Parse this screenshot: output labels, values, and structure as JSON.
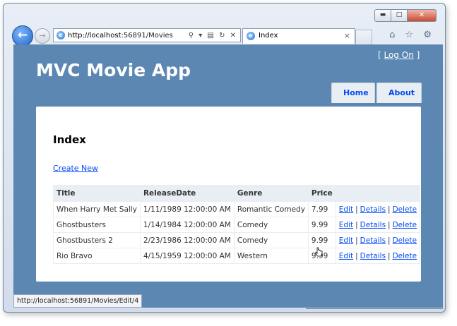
{
  "browser": {
    "address_host": "http://localhost",
    "address_path": ":56891/Movies",
    "tab_title": "Index",
    "tab_close": "×",
    "status_url": "http://localhost:56891/Movies/Edit/4",
    "back_glyph": "←",
    "forward_glyph": "→",
    "address_tools": "⚲ ▾ ▤ ↻ ✕",
    "window_controls": {
      "min": "▬",
      "max": "□",
      "close": "✕"
    },
    "command_icons": "⌂ ☆ ⚙"
  },
  "site": {
    "logon_prefix": "[ ",
    "logon_label": "Log On",
    "logon_suffix": " ]",
    "title": "MVC Movie App",
    "nav": [
      "Home",
      "About"
    ]
  },
  "content": {
    "heading": "Index",
    "create_link": "Create New",
    "columns": [
      "Title",
      "ReleaseDate",
      "Genre",
      "Price",
      ""
    ],
    "rows": [
      {
        "title": "When Harry Met Sally",
        "release": "1/11/1989 12:00:00 AM",
        "genre": "Romantic Comedy",
        "price": "7.99"
      },
      {
        "title": "Ghostbusters",
        "release": "1/14/1984 12:00:00 AM",
        "genre": "Comedy",
        "price": "9.99"
      },
      {
        "title": "Ghostbusters 2",
        "release": "2/23/1986 12:00:00 AM",
        "genre": "Comedy",
        "price": "9.99"
      },
      {
        "title": "Rio Bravo",
        "release": "4/15/1959 12:00:00 AM",
        "genre": "Western",
        "price": "9.99"
      }
    ],
    "actions": {
      "edit": "Edit",
      "details": "Details",
      "delete": "Delete",
      "separator": "|"
    }
  },
  "colors": {
    "page_bg": "#5c87b2",
    "link": "#034af3",
    "nav_bg": "#e8eef4"
  }
}
